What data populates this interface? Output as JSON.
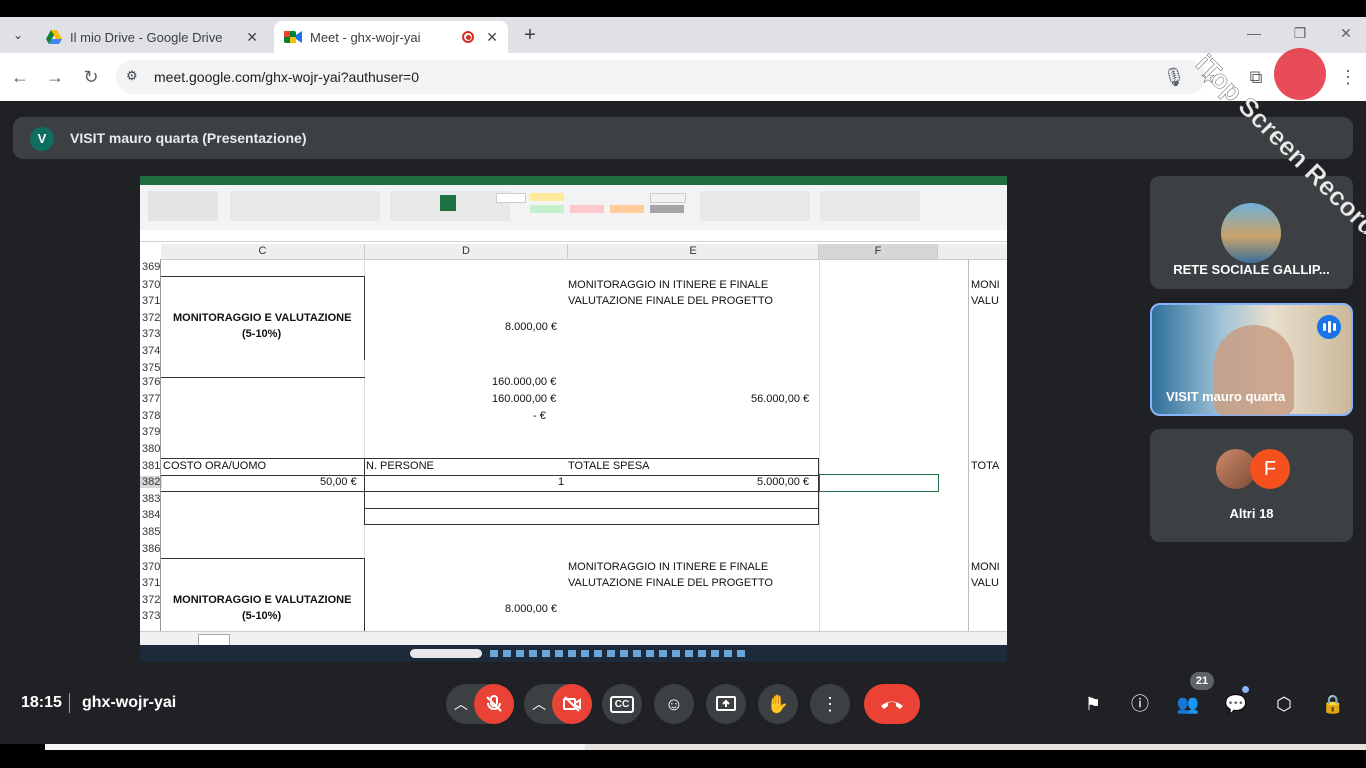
{
  "browser": {
    "tabs": [
      {
        "title": "Il mio Drive - Google Drive",
        "icon": "google-drive-icon"
      },
      {
        "title": "Meet - ghx-wojr-yai",
        "icon": "google-meet-icon",
        "recording": true
      }
    ],
    "url": "meet.google.com/ghx-wojr-yai?authuser=0"
  },
  "presentation": {
    "avatar_letter": "V",
    "title": "VISIT mauro quarta (Presentazione)"
  },
  "spreadsheet": {
    "columns": [
      "C",
      "D",
      "E",
      "F"
    ],
    "rows": [
      {
        "num": "369"
      },
      {
        "num": "370"
      },
      {
        "num": "371"
      },
      {
        "num": "372"
      },
      {
        "num": "373"
      },
      {
        "num": "374"
      },
      {
        "num": "375"
      },
      {
        "num": "376"
      },
      {
        "num": "377"
      },
      {
        "num": "378"
      },
      {
        "num": "379"
      },
      {
        "num": "380"
      },
      {
        "num": "381"
      },
      {
        "num": "382"
      },
      {
        "num": "383"
      },
      {
        "num": "384"
      },
      {
        "num": "385"
      },
      {
        "num": "386"
      },
      {
        "num": "370"
      },
      {
        "num": "371"
      },
      {
        "num": "372"
      },
      {
        "num": "373"
      }
    ],
    "cells": {
      "block1_e1": "MONITORAGGIO IN ITINERE E FINALE",
      "block1_e2": "VALUTAZIONE FINALE DEL PROGETTO",
      "block1_c1": "MONITORAGGIO E VALUTAZIONE",
      "block1_c2": "(5-10%)",
      "block1_d": "8.000,00 €",
      "g1": "MONI",
      "g2": "VALU",
      "d376": "160.000,00 €",
      "d377": "160.000,00 €",
      "d378": "-     €",
      "e377": "56.000,00 €",
      "c381": "COSTO ORA/UOMO",
      "d381": "N. PERSONE",
      "e381": "TOTALE SPESA",
      "g381": "TOTA",
      "c382": "50,00 €",
      "d382": "1",
      "e382": "5.000,00 €",
      "block2_e1": "MONITORAGGIO IN ITINERE E FINALE",
      "block2_e2": "VALUTAZIONE FINALE DEL PROGETTO",
      "block2_c1": "MONITORAGGIO E VALUTAZIONE",
      "block2_c2": "(5-10%)",
      "block2_d": "8.000,00 €",
      "g2_1": "MONI",
      "g2_2": "VALU"
    }
  },
  "participants": [
    {
      "name": "RETE SOCIALE GALLIP...",
      "type": "image-avatar"
    },
    {
      "name": "VISIT mauro quarta",
      "type": "video",
      "speaking": true
    },
    {
      "name": "Altri 18",
      "type": "group",
      "avatar_letter": "F"
    }
  ],
  "bottom_bar": {
    "time": "18:15",
    "meeting_code": "ghx-wojr-yai",
    "participants_count": "21"
  },
  "colors": {
    "meet_bg": "#202124",
    "tile_bg": "#3c4043",
    "red": "#ea4335",
    "speaking_blue": "#1a73e8"
  }
}
